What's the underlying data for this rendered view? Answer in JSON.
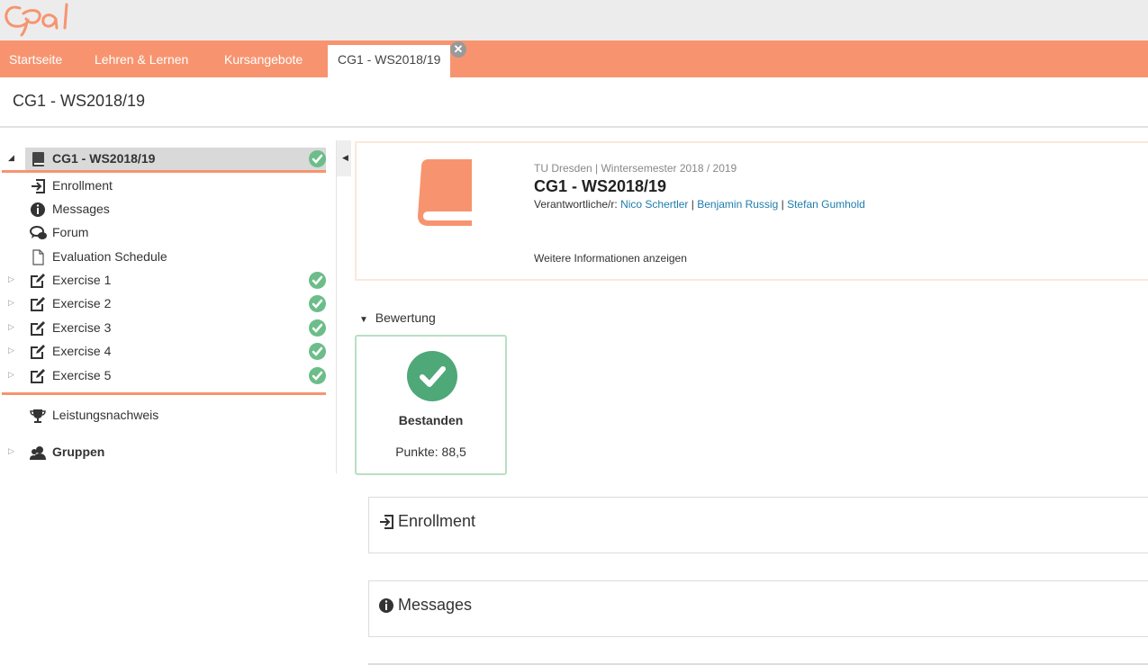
{
  "app": {
    "logo_text": "Opal"
  },
  "nav": {
    "tabs": [
      {
        "label": "Startseite"
      },
      {
        "label": "Lehren & Lernen"
      },
      {
        "label": "Kursangebote"
      },
      {
        "label": "CG1 - WS2018/19",
        "active": true
      }
    ],
    "close_label": "✕"
  },
  "page": {
    "title": "CG1 - WS2018/19"
  },
  "tree": {
    "root": {
      "label": "CG1 - WS2018/19",
      "passed": true
    },
    "items": [
      {
        "label": "Enrollment",
        "icon": "enrollment-icon"
      },
      {
        "label": "Messages",
        "icon": "info-icon"
      },
      {
        "label": "Forum",
        "icon": "forum-icon"
      },
      {
        "label": "Evaluation Schedule",
        "icon": "document-icon"
      },
      {
        "label": "Exercise 1",
        "icon": "edit-icon",
        "passed": true
      },
      {
        "label": "Exercise 2",
        "icon": "edit-icon",
        "passed": true
      },
      {
        "label": "Exercise 3",
        "icon": "edit-icon",
        "passed": true
      },
      {
        "label": "Exercise 4",
        "icon": "edit-icon",
        "passed": true
      },
      {
        "label": "Exercise 5",
        "icon": "edit-icon",
        "passed": true
      }
    ],
    "extra": [
      {
        "label": "Leistungsnachweis",
        "icon": "trophy-icon"
      },
      {
        "label": "Gruppen",
        "icon": "group-icon"
      }
    ]
  },
  "course": {
    "meta": "TU Dresden | Wintersemester 2018 / 2019",
    "name": "CG1 - WS2018/19",
    "responsible_label": "Verantwortliche/r:",
    "responsible": [
      "Nico Schertler",
      "Benjamin Russig",
      "Stefan Gumhold"
    ],
    "more_info": "Weitere Informationen anzeigen"
  },
  "assessment": {
    "heading": "Bewertung",
    "status": "Bestanden",
    "points": "Punkte: 88,5"
  },
  "sections": [
    {
      "label": "Enrollment",
      "icon": "enrollment-icon"
    },
    {
      "label": "Messages",
      "icon": "info-icon"
    }
  ],
  "colors": {
    "brand": "#f7946f",
    "pass": "#6cbd8a",
    "link": "#1e7dab"
  }
}
